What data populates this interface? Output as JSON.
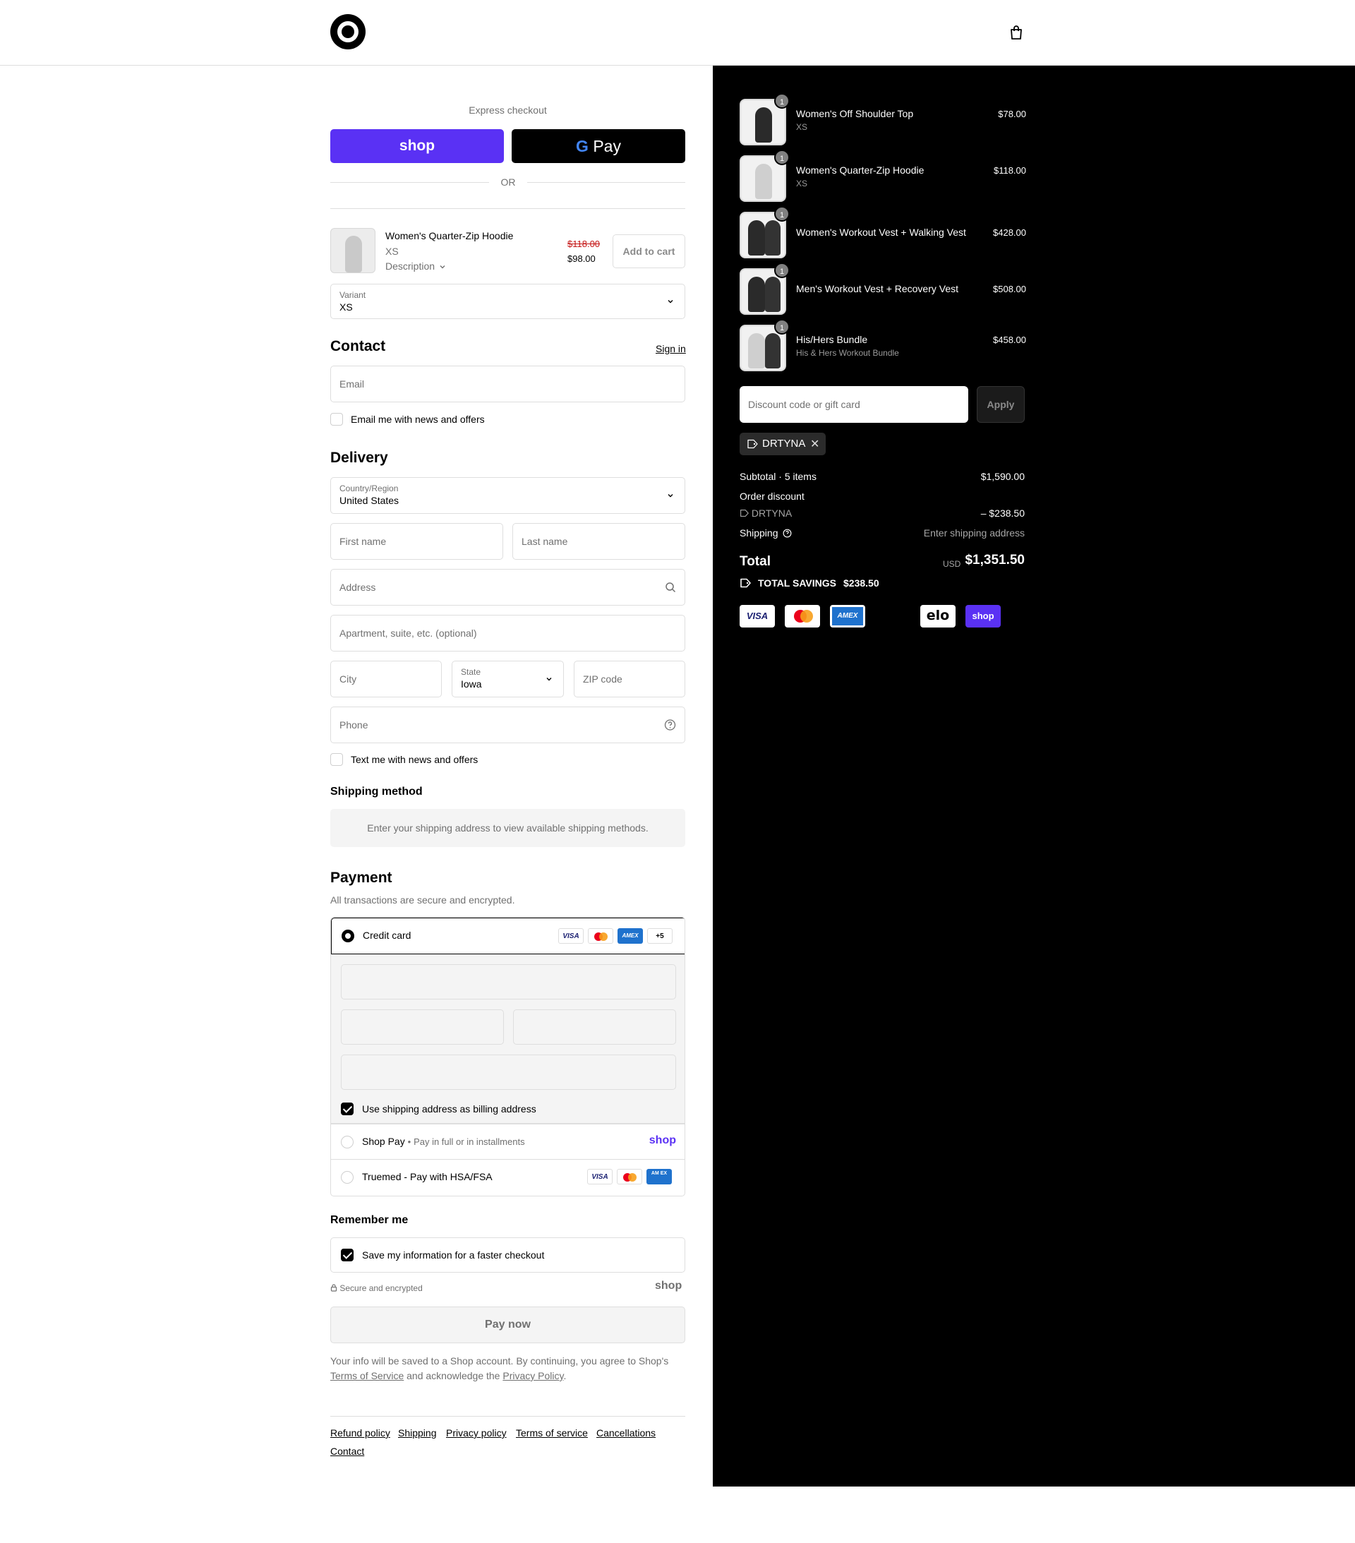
{
  "header": {
    "logo": "brand-logo",
    "cart_icon": "shopping-bag-icon"
  },
  "express": {
    "title": "Express checkout",
    "shop_label": "shop",
    "gpay_g": "G",
    "gpay_label": "Pay",
    "or": "OR"
  },
  "upsell": {
    "name": "Women's Quarter-Zip Hoodie",
    "variant": "XS",
    "description": "Description",
    "old_price": "$118.00",
    "new_price": "$98.00",
    "add_to_cart": "Add to cart",
    "variant_label": "Variant",
    "variant_value": "XS"
  },
  "contact": {
    "title": "Contact",
    "sign_in": "Sign in",
    "email_placeholder": "Email",
    "news_label": "Email me with news and offers"
  },
  "delivery": {
    "title": "Delivery",
    "country_label": "Country/Region",
    "country_value": "United States",
    "first_name": "First name",
    "last_name": "Last name",
    "address": "Address",
    "apartment": "Apartment, suite, etc. (optional)",
    "city": "City",
    "state_label": "State",
    "state_value": "Iowa",
    "zip": "ZIP code",
    "phone": "Phone",
    "sms_label": "Text me with news and offers"
  },
  "shipping_method": {
    "title": "Shipping method",
    "note": "Enter your shipping address to view available shipping methods."
  },
  "payment": {
    "title": "Payment",
    "subtitle": "All transactions are secure and encrypted.",
    "credit_card": "Credit card",
    "more_cards": "+5",
    "billing_label": "Use shipping address as billing address",
    "shop_pay": "Shop Pay",
    "shop_pay_sub": "Pay in full or in installments",
    "shop_pay_logo": "shop",
    "truemed": "Truemed - Pay with HSA/FSA",
    "card_visa": "VISA",
    "card_amex": "AMEX",
    "card_amex_stacked": "AM EX"
  },
  "remember": {
    "title": "Remember me",
    "save_label": "Save my information for a faster checkout",
    "secure": "Secure and encrypted",
    "shop_logo": "shop"
  },
  "pay_now": "Pay now",
  "legal": {
    "text1": "Your info will be saved to a Shop account. By continuing, you agree to Shop's",
    "terms": "Terms of Service",
    "text2": " and acknowledge the ",
    "privacy": "Privacy Policy",
    "text3": "."
  },
  "footer": {
    "links": [
      "Refund policy",
      "Shipping",
      "Privacy policy",
      "Terms of service",
      "Cancellations",
      "Contact"
    ]
  },
  "summary": {
    "items": [
      {
        "name": "Women's Off Shoulder Top",
        "variant": "XS",
        "price": "$78.00",
        "qty": "1"
      },
      {
        "name": "Women's Quarter-Zip Hoodie",
        "variant": "XS",
        "price": "$118.00",
        "qty": "1"
      },
      {
        "name": "Women's Workout Vest + Walking Vest",
        "variant": "",
        "price": "$428.00",
        "qty": "1"
      },
      {
        "name": "Men's Workout Vest + Recovery Vest",
        "variant": "",
        "price": "$508.00",
        "qty": "1"
      },
      {
        "name": "His/Hers Bundle",
        "variant": "His & Hers Workout Bundle",
        "price": "$458.00",
        "qty": "1"
      }
    ],
    "discount_placeholder": "Discount code or gift card",
    "apply": "Apply",
    "code": "DRTYNA",
    "subtotal_label": "Subtotal · 5 items",
    "subtotal_value": "$1,590.00",
    "order_discount_label": "Order discount",
    "order_discount_code": "DRTYNA",
    "order_discount_value": "– $238.50",
    "shipping_label": "Shipping",
    "shipping_value": "Enter shipping address",
    "total_label": "Total",
    "currency": "USD",
    "total_value": "$1,351.50",
    "savings_label": "TOTAL SAVINGS",
    "savings_value": "$238.50",
    "payment_logos": {
      "visa": "VISA",
      "amex": "AMEX",
      "elo": "elo",
      "shop": "shop"
    }
  }
}
